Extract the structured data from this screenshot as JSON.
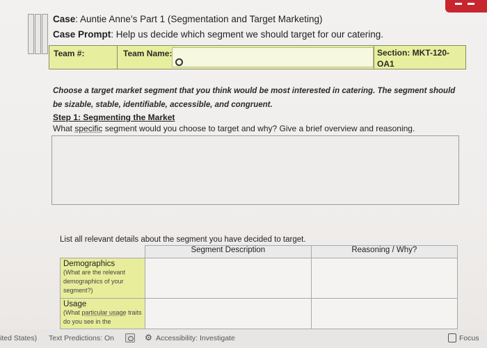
{
  "header": {
    "case_label": "Case",
    "case_text": ": Auntie Anne’s Part 1 (Segmentation and Target Marketing)",
    "prompt_label": "Case Prompt",
    "prompt_text": ":  Help us decide which segment we should target for our catering."
  },
  "team_bar": {
    "team_num_label": "Team #:",
    "team_name_label": "Team Name:",
    "section_label_1": "Section: MKT-120-",
    "section_label_2": "OA1"
  },
  "instruction": "Choose a target market segment that you think would be most interested in catering. The segment should be sizable, stable, identifiable, accessible, and congruent.",
  "step": {
    "title": "Step 1: Segmenting the Market",
    "question_part1": "What ",
    "question_link": "specific",
    "question_part2": " segment would you choose to target and why? Give a brief overview and reasoning."
  },
  "segment_table": {
    "intro": "List all relevant details about the segment you have decided to target.",
    "headers": [
      "",
      "Segment Description",
      "Reasoning / Why?"
    ],
    "rows": [
      {
        "title": "Demographics",
        "hint": "(What are the relevant demographics of your segment?)"
      },
      {
        "title": "Usage",
        "hint_part1": "(What ",
        "hint_link": "particular usage",
        "hint_part2": " traits do you see in the"
      }
    ]
  },
  "status_bar": {
    "language": "ited States)",
    "text_predictions": "Text Predictions: On",
    "accessibility": "Accessibility: Investigate",
    "focus": "Focus"
  },
  "colors": {
    "highlight": "#e7ef9e",
    "accent_red": "#c8262e"
  }
}
